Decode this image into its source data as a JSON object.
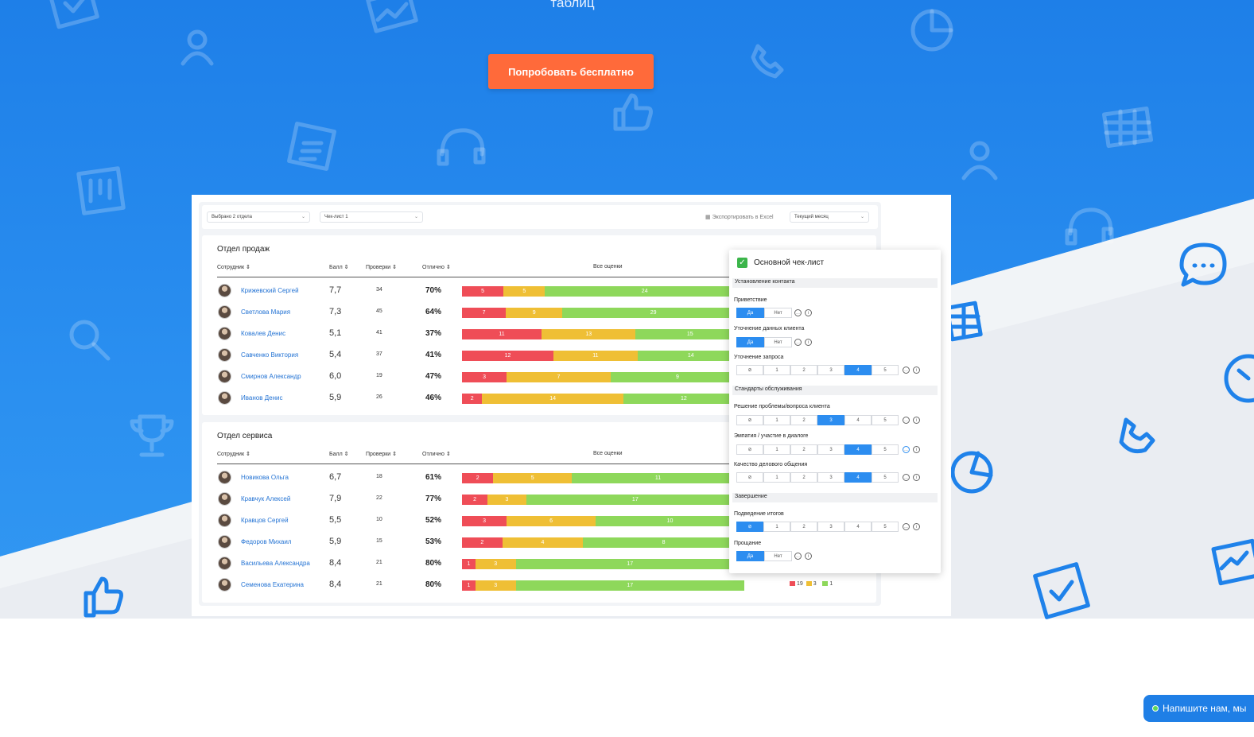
{
  "hero": {
    "subtitle": "таблиц",
    "cta_label": "Попробовать бесплатно"
  },
  "colors": {
    "brand_blue": "#1e7fe8",
    "cta_orange": "#ff6a3a",
    "bad": "#ef4d57",
    "medium": "#efbf35",
    "good": "#8ed85b"
  },
  "toolbar": {
    "departments_select": "Выбрано 2 отдела",
    "checklist_select": "Чек-лист 1",
    "export_label": "Экспортировать в Excel",
    "period_select": "Текущий месяц"
  },
  "columns": {
    "employee": "Сотрудник",
    "score": "Балл",
    "checks": "Проверки",
    "excellent": "Отлично",
    "all_grades": "Все оценки"
  },
  "departments": [
    {
      "title": "Отдел продаж",
      "rows": [
        {
          "name": "Крижевский Сергей",
          "score": "7,7",
          "checks": "34",
          "pct": "70%",
          "r": 5,
          "y": 5,
          "g": 24
        },
        {
          "name": "Светлова Мария",
          "score": "7,3",
          "checks": "45",
          "pct": "64%",
          "r": 7,
          "y": 9,
          "g": 29
        },
        {
          "name": "Ковалев Денис",
          "score": "5,1",
          "checks": "41",
          "pct": "37%",
          "r": 11,
          "y": 13,
          "g": 15
        },
        {
          "name": "Савченко Виктория",
          "score": "5,4",
          "checks": "37",
          "pct": "41%",
          "r": 12,
          "y": 11,
          "g": 14
        },
        {
          "name": "Смирнов Александр",
          "score": "6,0",
          "checks": "19",
          "pct": "47%",
          "r": 3,
          "y": 7,
          "g": 9
        },
        {
          "name": "Иванов Денис",
          "score": "5,9",
          "checks": "26",
          "pct": "46%",
          "r": 2,
          "y": 14,
          "g": 12
        }
      ]
    },
    {
      "title": "Отдел сервиса",
      "rows": [
        {
          "name": "Новикова Ольга",
          "score": "6,7",
          "checks": "18",
          "pct": "61%",
          "r": 2,
          "y": 5,
          "g": 11
        },
        {
          "name": "Кравчук Алексей",
          "score": "7,9",
          "checks": "22",
          "pct": "77%",
          "r": 2,
          "y": 3,
          "g": 17
        },
        {
          "name": "Кравцов Сергей",
          "score": "5,5",
          "checks": "10",
          "pct": "52%",
          "r": 3,
          "y": 6,
          "g": 10
        },
        {
          "name": "Федоров Михаил",
          "score": "5,9",
          "checks": "15",
          "pct": "53%",
          "r": 2,
          "y": 4,
          "g": 8
        },
        {
          "name": "Васильева Александра",
          "score": "8,4",
          "checks": "21",
          "pct": "80%",
          "r": 1,
          "y": 3,
          "g": 17
        },
        {
          "name": "Семенова Екатерина",
          "score": "8,4",
          "checks": "21",
          "pct": "80%",
          "r": 1,
          "y": 3,
          "g": 17
        }
      ]
    }
  ],
  "flags_last_row": {
    "red": "19",
    "yellow": "3",
    "green": "1"
  },
  "checklist": {
    "title": "Основной чек-лист",
    "yes": "Да",
    "no": "Нет",
    "scale": [
      "1",
      "2",
      "3",
      "4",
      "5"
    ],
    "sections": {
      "s1": "Установление контакта",
      "s2": "Стандарты обслуживания",
      "s3": "Завершение"
    },
    "items": {
      "greeting": "Приветствие",
      "client_data": "Уточнение данных клиента",
      "request": "Уточнение запроса",
      "problem": "Решение проблемы/вопроса клиента",
      "empathy": "Эмпатия / участие в диалоге",
      "quality": "Качество делового общения",
      "summary": "Подведение итогов",
      "farewell": "Прощание"
    },
    "selected": {
      "request": "4",
      "problem": "3",
      "empathy": "4",
      "quality": "4",
      "summary": "none"
    }
  },
  "chat": {
    "label": "Напишите нам, мы"
  }
}
